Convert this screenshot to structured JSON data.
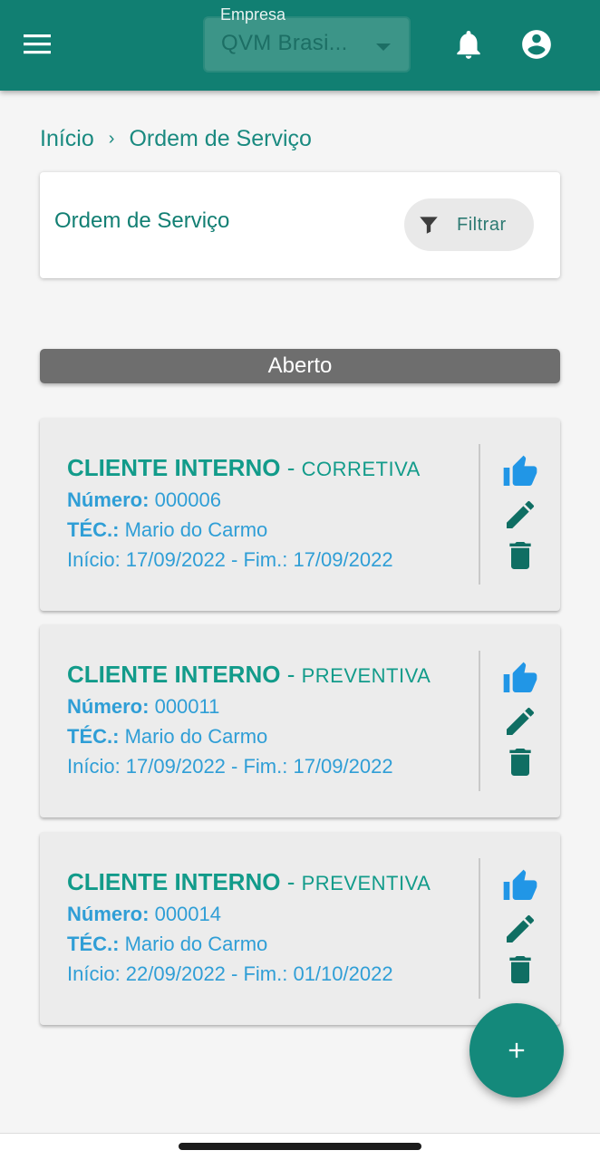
{
  "appbar": {
    "company_label": "Empresa",
    "company_value": "QVM Brasi...",
    "accent_color": "#117f72"
  },
  "breadcrumb": {
    "home": "Início",
    "current": "Ordem de Serviço"
  },
  "header_card": {
    "title": "Ordem de Serviço",
    "filter_label": "Filtrar"
  },
  "section": {
    "status": "Aberto"
  },
  "orders": [
    {
      "client": "CLIENTE INTERNO",
      "type": "CORRETIVA",
      "numero_label": "Número:",
      "numero": "000006",
      "tec_label": "TÉC.:",
      "tec": "Mario do Carmo",
      "dates": "Início: 17/09/2022 - Fim.: 17/09/2022"
    },
    {
      "client": "CLIENTE INTERNO",
      "type": "PREVENTIVA",
      "numero_label": "Número:",
      "numero": "000011",
      "tec_label": "TÉC.:",
      "tec": "Mario do Carmo",
      "dates": "Início: 17/09/2022 - Fim.: 17/09/2022"
    },
    {
      "client": "CLIENTE INTERNO",
      "type": "PREVENTIVA",
      "numero_label": "Número:",
      "numero": "000014",
      "tec_label": "TÉC.:",
      "tec": "Mario do Carmo",
      "dates": "Início: 22/09/2022 - Fim.: 01/10/2022"
    }
  ],
  "icons": {
    "menu": "menu-icon",
    "notifications": "bell-icon",
    "account": "account-circle-icon",
    "filter": "filter-icon",
    "approve": "thumb-up-icon",
    "edit": "pencil-icon",
    "delete": "trash-icon",
    "add": "plus-icon"
  }
}
